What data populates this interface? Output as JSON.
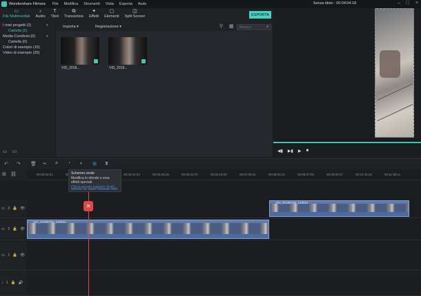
{
  "app": {
    "name": "Wondershare Filmora",
    "project_title": "Senza titolo : 00:04:04:18",
    "menu": [
      "File",
      "Modifica",
      "Strumenti",
      "Vista",
      "Esporta",
      "Aiuto"
    ]
  },
  "toolbar": {
    "tabs": [
      {
        "label": "File Multimediali",
        "icon": "folder-icon"
      },
      {
        "label": "Audio",
        "icon": "music-note-icon"
      },
      {
        "label": "Titoli",
        "icon": "text-icon"
      },
      {
        "label": "Transizione",
        "icon": "transition-icon"
      },
      {
        "label": "Effetti",
        "icon": "effects-icon"
      },
      {
        "label": "Elementi",
        "icon": "elements-icon"
      },
      {
        "label": "Split Screen",
        "icon": "split-screen-icon"
      }
    ],
    "export_label": "ESPORTA"
  },
  "sidebar": {
    "items": [
      {
        "label": "I miei progetti (2)",
        "level": 0,
        "selected": false
      },
      {
        "label": "Cartella (2)",
        "level": 1,
        "selected": true
      },
      {
        "label": "Media Condivisi (0)",
        "level": 0,
        "selected": false
      },
      {
        "label": "Cartella (0)",
        "level": 1,
        "selected": false
      },
      {
        "label": "Colori di esempio (15)",
        "level": 0,
        "selected": false
      },
      {
        "label": "Video di esempio (20)",
        "level": 0,
        "selected": false
      }
    ]
  },
  "media": {
    "import_label": "Importa",
    "record_label": "Registrazione",
    "search_placeholder": "Ricerca",
    "clips": [
      {
        "label": "VID_2018..."
      },
      {
        "label": "VID_2018..."
      }
    ]
  },
  "tooltip": {
    "title": "Schermo verde",
    "line1": "Modifica lo sfondo o crea",
    "line2": "effetti speciali.",
    "link": "Clicca qui per saperne di più..."
  },
  "ruler": {
    "ticks": [
      "00:00:53:21",
      "00:01:47:13",
      "00:02:41:05",
      "00:03:34:23",
      "00:04:28:15",
      "00:05:22:07",
      "00:06:15:29",
      "00:07:09:21",
      "00:08:03:13",
      "00:08:57:05",
      "00:09:50:27",
      "00:10:44:19",
      "00:11:38:11"
    ]
  },
  "timeline": {
    "tracks": [
      {
        "id": "3",
        "kind": "video"
      },
      {
        "id": "2",
        "kind": "video"
      },
      {
        "id": "1",
        "kind": "video"
      },
      {
        "id": "1",
        "kind": "audio"
      }
    ],
    "clips": [
      {
        "label": "VID_20180706_132531",
        "track": "3"
      },
      {
        "label": "VID_20180706_132531",
        "track": "2"
      }
    ]
  },
  "colors": {
    "accent": "#3fc7b4",
    "playhead": "#e04848",
    "clip": "#5d7bb0"
  }
}
